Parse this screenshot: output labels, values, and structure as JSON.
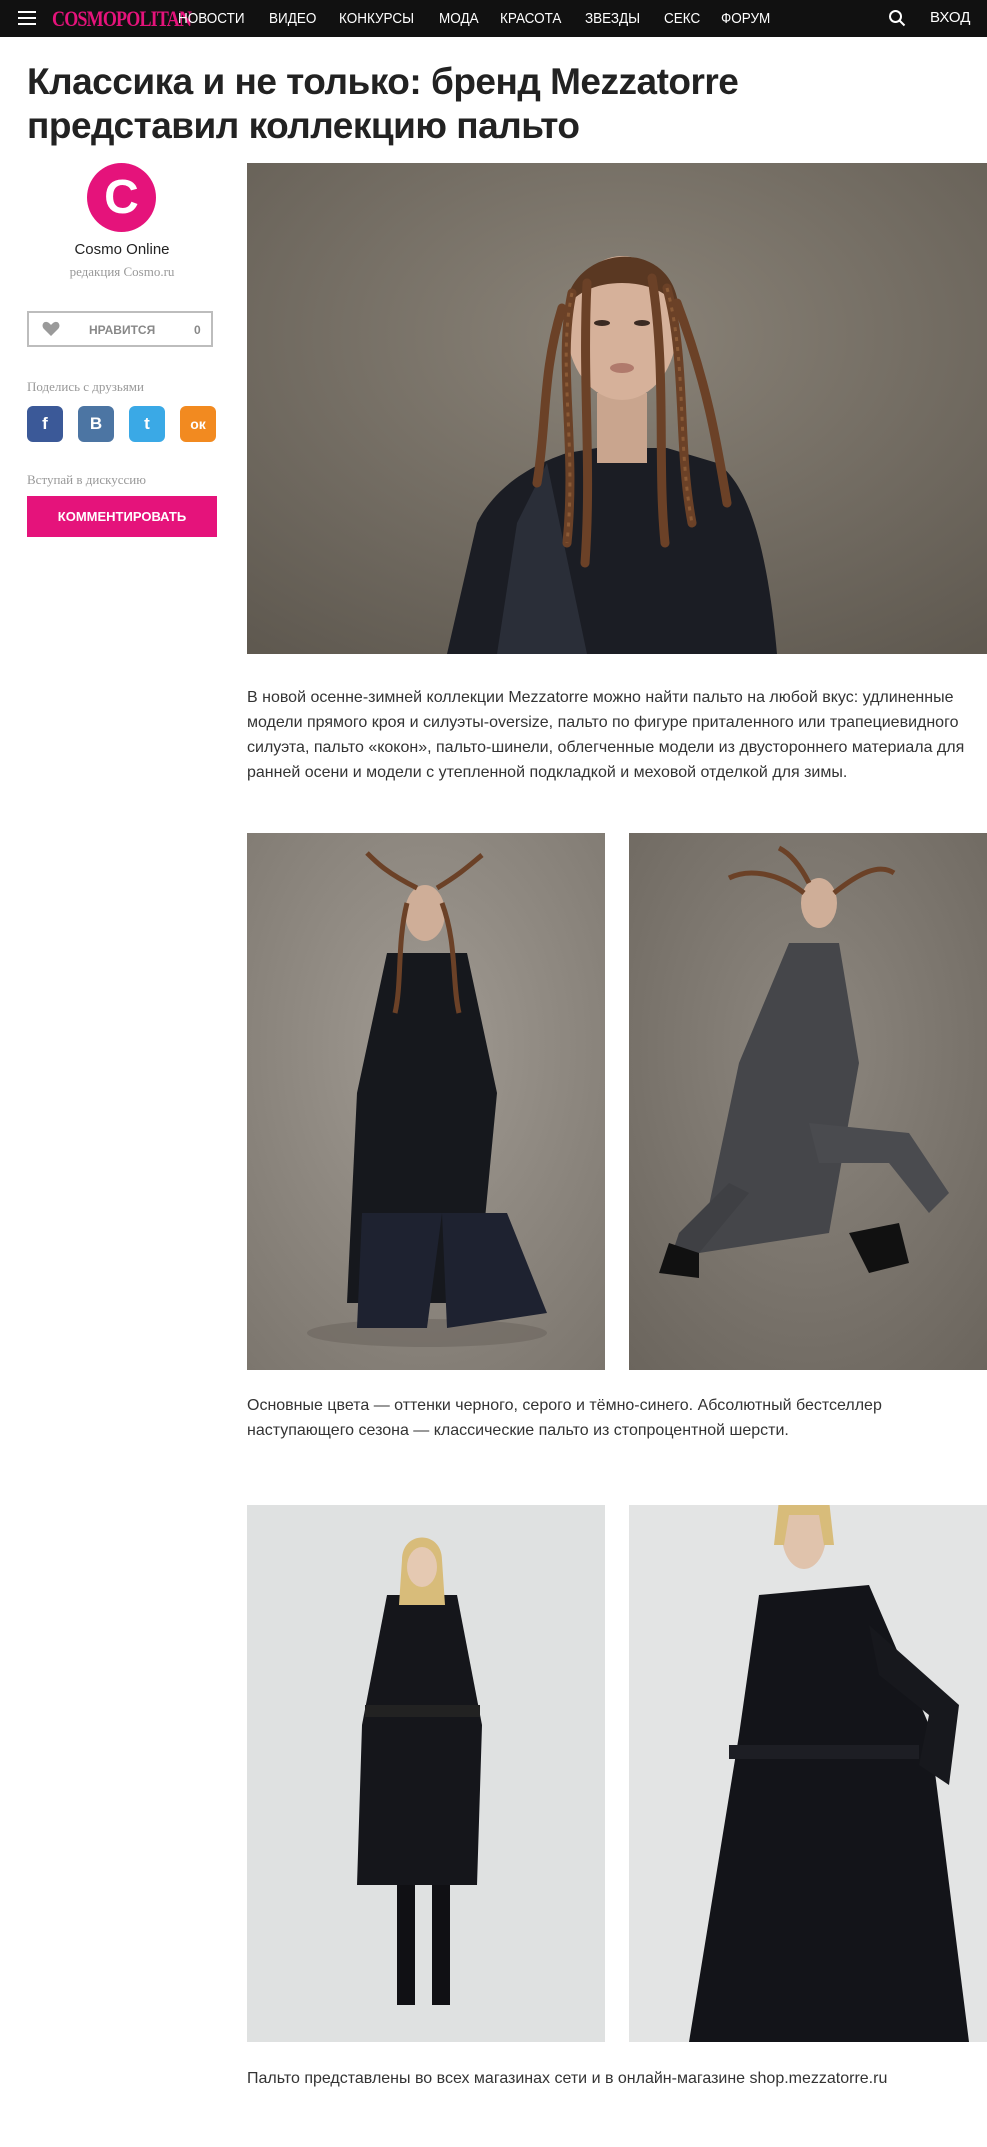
{
  "nav": {
    "logo": "COSMOPOLITAN",
    "items": [
      "НОВОСТИ",
      "ВИДЕО",
      "КОНКУРСЫ",
      "МОДА",
      "КРАСОТА",
      "ЗВЕЗДЫ",
      "СЕКС",
      "ФОРУМ"
    ],
    "login": "ВХОД"
  },
  "article": {
    "title": "Классика и не только: бренд Mezzatorre представил коллекцию пальто",
    "paragraphs": [
      "В новой осенне-зимней коллекции Mezzatorre можно найти пальто на любой вкус: удлиненные модели прямого кроя и силуэты-oversize, пальто по фигуре приталенного или трапециевидного силуэта, пальто «кокон», пальто-шинели, облегченные модели из двустороннего материала для ранней осени и модели с утепленной подкладкой и меховой отделкой для зимы.",
      "Основные цвета — оттенки черного, серого и тёмно-синего. Абсолютный бестселлер наступающего сезона — классические пальто из стопроцентной шерсти.",
      "Пальто представлены во всех магазинах сети и в онлайн-магазине shop.mezzatorre.ru"
    ]
  },
  "sidebar": {
    "avatar_letter": "C",
    "author_name": "Cosmo Online",
    "author_sub": "редакция Cosmo.ru",
    "like_label": "НРАВИТСЯ",
    "like_count": "0",
    "share_label": "Поделись с друзьями",
    "socials": [
      {
        "name": "facebook",
        "glyph": "f",
        "color": "#3b5998"
      },
      {
        "name": "vkontakte",
        "glyph": "В",
        "color": "#4c75a3"
      },
      {
        "name": "twitter",
        "glyph": "t",
        "color": "#3aa9e6"
      },
      {
        "name": "odnoklassniki",
        "glyph": "ок",
        "color": "#f28a20"
      }
    ],
    "discuss_label": "Вступай в дискуссию",
    "comment_button": "КОММЕНТИРОВАТЬ"
  },
  "colors": {
    "brand": "#e5137b",
    "topbar": "#111111"
  }
}
